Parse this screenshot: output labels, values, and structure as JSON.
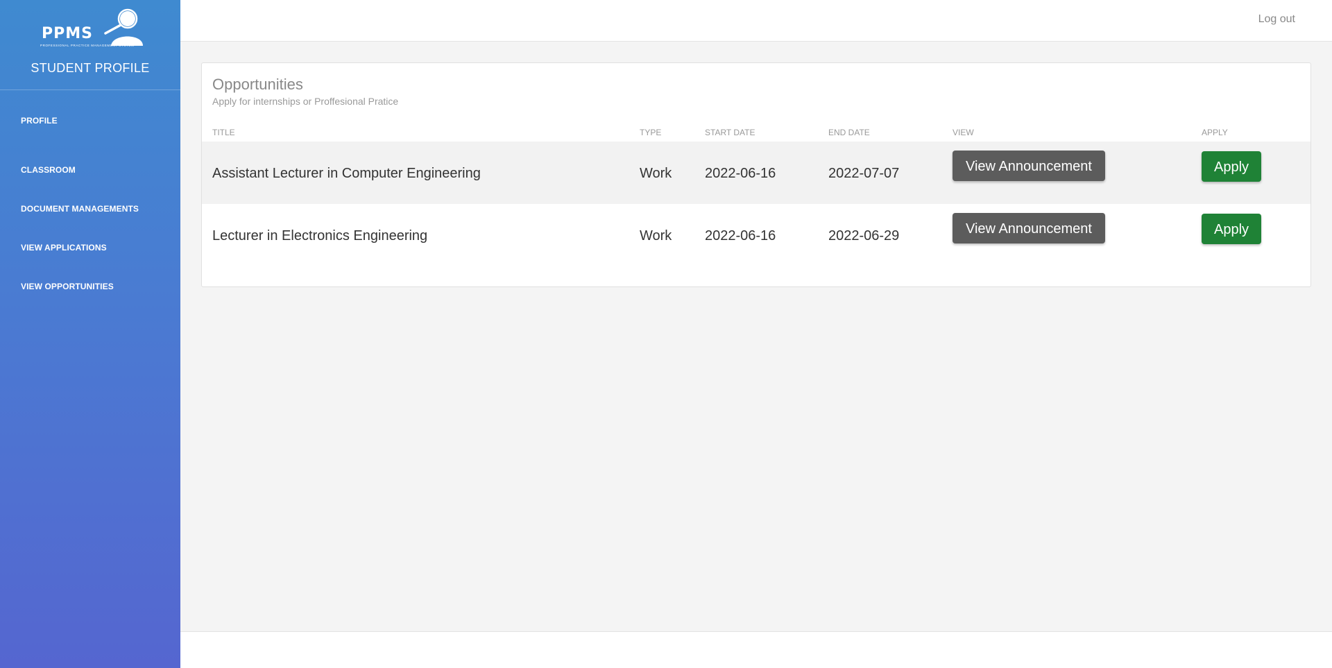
{
  "sidebar": {
    "logo_text": "PPMS",
    "logo_subtitle": "PROFESSIONAL PRACTICE MANAGEMENT SYSTEM",
    "title": "STUDENT PROFILE",
    "items": [
      {
        "label": "PROFILE"
      },
      {
        "label": "CLASSROOM"
      },
      {
        "label": "DOCUMENT MANAGEMENTS"
      },
      {
        "label": "VIEW APPLICATIONS"
      },
      {
        "label": "VIEW OPPORTUNITIES"
      }
    ]
  },
  "header": {
    "logout_label": "Log out"
  },
  "main": {
    "card_title": "Opportunities",
    "card_subtitle": "Apply for internships or Proffesional Pratice",
    "columns": [
      "TITLE",
      "TYPE",
      "START DATE",
      "END DATE",
      "VIEW",
      "APPLY"
    ],
    "rows": [
      {
        "title": "Assistant Lecturer in Computer Engineering",
        "type": "Work",
        "start_date": "2022-06-16",
        "end_date": "2022-07-07",
        "view_label": "View Announcement",
        "apply_label": "Apply"
      },
      {
        "title": "Lecturer in Electronics Engineering",
        "type": "Work",
        "start_date": "2022-06-16",
        "end_date": "2022-06-29",
        "view_label": "View Announcement",
        "apply_label": "Apply"
      }
    ]
  },
  "colors": {
    "sidebar_top": "#3f8ad0",
    "sidebar_bottom": "#5566d0",
    "view_button": "#5c5c5c",
    "apply_button": "#1f8236"
  }
}
